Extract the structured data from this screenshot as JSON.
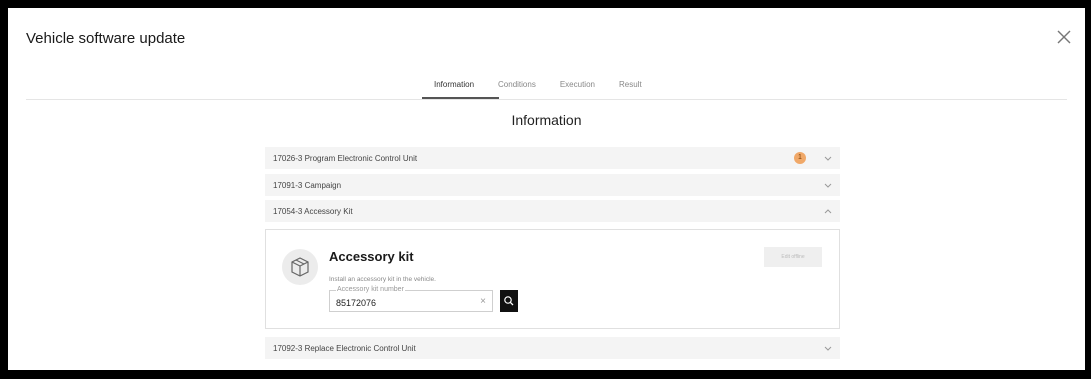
{
  "dialog": {
    "title": "Vehicle software update",
    "close_icon": "close-icon"
  },
  "tabs": [
    {
      "label": "Information",
      "active": true
    },
    {
      "label": "Conditions",
      "active": false
    },
    {
      "label": "Execution",
      "active": false
    },
    {
      "label": "Result",
      "active": false
    }
  ],
  "section_title": "Information",
  "items": [
    {
      "label": "17026-3 Program Electronic Control Unit",
      "badge": "1",
      "expanded": false
    },
    {
      "label": "17091-3 Campaign",
      "expanded": false
    },
    {
      "label": "17054-3 Accessory Kit",
      "expanded": true
    },
    {
      "label": "17092-3 Replace Electronic Control Unit",
      "expanded": false
    }
  ],
  "accessory_panel": {
    "icon": "package-icon",
    "title": "Accessory kit",
    "description": "Install an accessory kit in the vehicle.",
    "field_label": "Accessory kit number",
    "field_value": "85172076",
    "clear_symbol": "×",
    "edit_button_label": "Edit offline"
  },
  "colors": {
    "badge": "#f0a868",
    "row_bg": "#f4f4f4",
    "search_button": "#111111"
  }
}
